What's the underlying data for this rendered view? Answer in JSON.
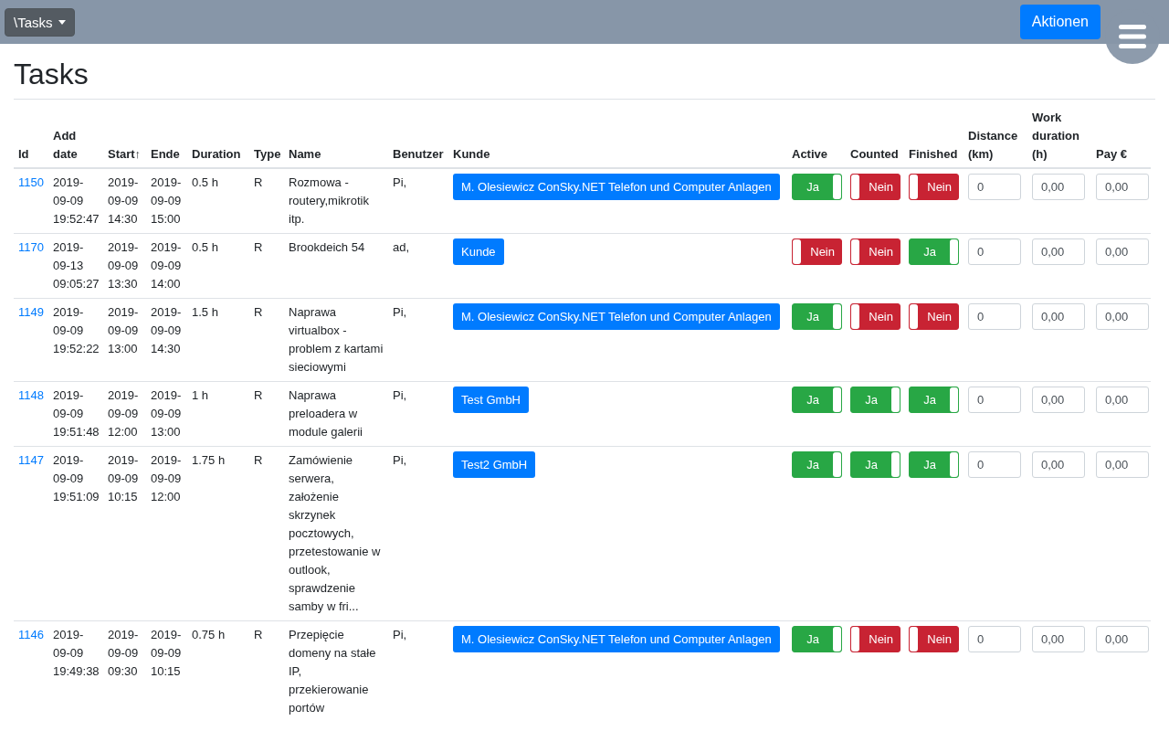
{
  "navbar": {
    "dropdown": "\\Tasks",
    "action_button": "Aktionen"
  },
  "title": "Tasks",
  "table": {
    "columns": [
      "Id",
      "Add date",
      "Start↑",
      "Ende",
      "Duration",
      "Type",
      "Name",
      "Benutzer",
      "Kunde",
      "Active",
      "Counted",
      "Finished",
      "Distance (km)",
      "Work duration (h)",
      "Pay €"
    ],
    "rows": [
      {
        "id": "1150",
        "add_date": "2019-09-09 19:52:47",
        "start": "2019-09-09 14:30",
        "ende": "2019-09-09 15:00",
        "duration": "0.5 h",
        "type": "R",
        "name": "Rozmowa - routery,mikrotik itp.",
        "benutzer": "Pi,",
        "kunde": "M. Olesiewicz ConSky.NET Telefon und Computer Anlagen",
        "active": {
          "label": "Ja",
          "on": true
        },
        "counted": {
          "label": "Nein",
          "on": false
        },
        "finished": {
          "label": "Nein",
          "on": false
        },
        "distance": "0",
        "work_duration": "0,00",
        "pay": "0,00"
      },
      {
        "id": "1170",
        "add_date": "2019-09-13 09:05:27",
        "start": "2019-09-09 13:30",
        "ende": "2019-09-09 14:00",
        "duration": "0.5 h",
        "type": "R",
        "name": "Brookdeich 54",
        "benutzer": "ad,",
        "kunde": "Kunde",
        "active": {
          "label": "Nein",
          "on": false
        },
        "counted": {
          "label": "Nein",
          "on": false
        },
        "finished": {
          "label": "Ja",
          "on": true
        },
        "distance": "0",
        "work_duration": "0,00",
        "pay": "0,00"
      },
      {
        "id": "1149",
        "add_date": "2019-09-09 19:52:22",
        "start": "2019-09-09 13:00",
        "ende": "2019-09-09 14:30",
        "duration": "1.5 h",
        "type": "R",
        "name": "Naprawa virtualbox - problem z kartami sieciowymi",
        "benutzer": "Pi,",
        "kunde": "M. Olesiewicz ConSky.NET Telefon und Computer Anlagen",
        "active": {
          "label": "Ja",
          "on": true
        },
        "counted": {
          "label": "Nein",
          "on": false
        },
        "finished": {
          "label": "Nein",
          "on": false
        },
        "distance": "0",
        "work_duration": "0,00",
        "pay": "0,00"
      },
      {
        "id": "1148",
        "add_date": "2019-09-09 19:51:48",
        "start": "2019-09-09 12:00",
        "ende": "2019-09-09 13:00",
        "duration": "1 h",
        "type": "R",
        "name": "Naprawa preloadera w module galerii",
        "benutzer": "Pi,",
        "kunde": "Test GmbH",
        "active": {
          "label": "Ja",
          "on": true
        },
        "counted": {
          "label": "Ja",
          "on": true
        },
        "finished": {
          "label": "Ja",
          "on": true
        },
        "distance": "0",
        "work_duration": "0,00",
        "pay": "0,00"
      },
      {
        "id": "1147",
        "add_date": "2019-09-09 19:51:09",
        "start": "2019-09-09 10:15",
        "ende": "2019-09-09 12:00",
        "duration": "1.75 h",
        "type": "R",
        "name": "Zamówienie serwera, założenie skrzynek pocztowych, przetestowanie w outlook, sprawdzenie samby w fri...",
        "benutzer": "Pi,",
        "kunde": "Test2 GmbH",
        "active": {
          "label": "Ja",
          "on": true
        },
        "counted": {
          "label": "Ja",
          "on": true
        },
        "finished": {
          "label": "Ja",
          "on": true
        },
        "distance": "0",
        "work_duration": "0,00",
        "pay": "0,00"
      },
      {
        "id": "1146",
        "add_date": "2019-09-09 19:49:38",
        "start": "2019-09-09 09:30",
        "ende": "2019-09-09 10:15",
        "duration": "0.75 h",
        "type": "R",
        "name": "Przepięcie domeny na stałe IP, przekierowanie portów",
        "benutzer": "Pi,",
        "kunde": "M. Olesiewicz ConSky.NET Telefon und Computer Anlagen",
        "active": {
          "label": "Ja",
          "on": true
        },
        "counted": {
          "label": "Nein",
          "on": false
        },
        "finished": {
          "label": "Nein",
          "on": false
        },
        "distance": "0",
        "work_duration": "0,00",
        "pay": "0,00"
      }
    ]
  }
}
